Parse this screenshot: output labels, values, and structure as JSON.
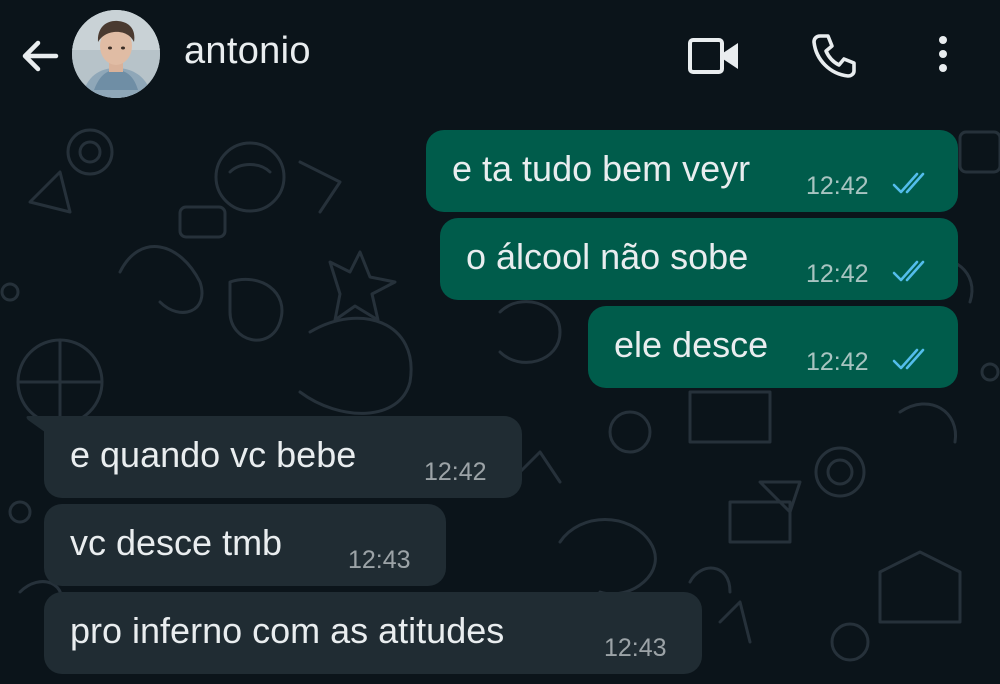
{
  "header": {
    "contact_name": "antonio",
    "icons": {
      "back": "arrow-left-icon",
      "video": "video-camera-icon",
      "call": "phone-icon",
      "menu": "more-vertical-icon"
    }
  },
  "colors": {
    "background": "#0b141a",
    "outgoing_bubble": "#005c4b",
    "incoming_bubble": "#202c33",
    "read_ticks": "#53bdeb",
    "text": "#e9edef"
  },
  "messages": [
    {
      "direction": "outgoing",
      "text": "e ta tudo bem veyr",
      "time": "12:42",
      "status": "read"
    },
    {
      "direction": "outgoing",
      "text": "o álcool não sobe",
      "time": "12:42",
      "status": "read"
    },
    {
      "direction": "outgoing",
      "text": "ele desce",
      "time": "12:42",
      "status": "read"
    },
    {
      "direction": "incoming",
      "text": "e quando vc bebe",
      "time": "12:42"
    },
    {
      "direction": "incoming",
      "text": "vc desce tmb",
      "time": "12:43"
    },
    {
      "direction": "incoming",
      "text": "pro inferno com as atitudes",
      "time": "12:43"
    }
  ]
}
